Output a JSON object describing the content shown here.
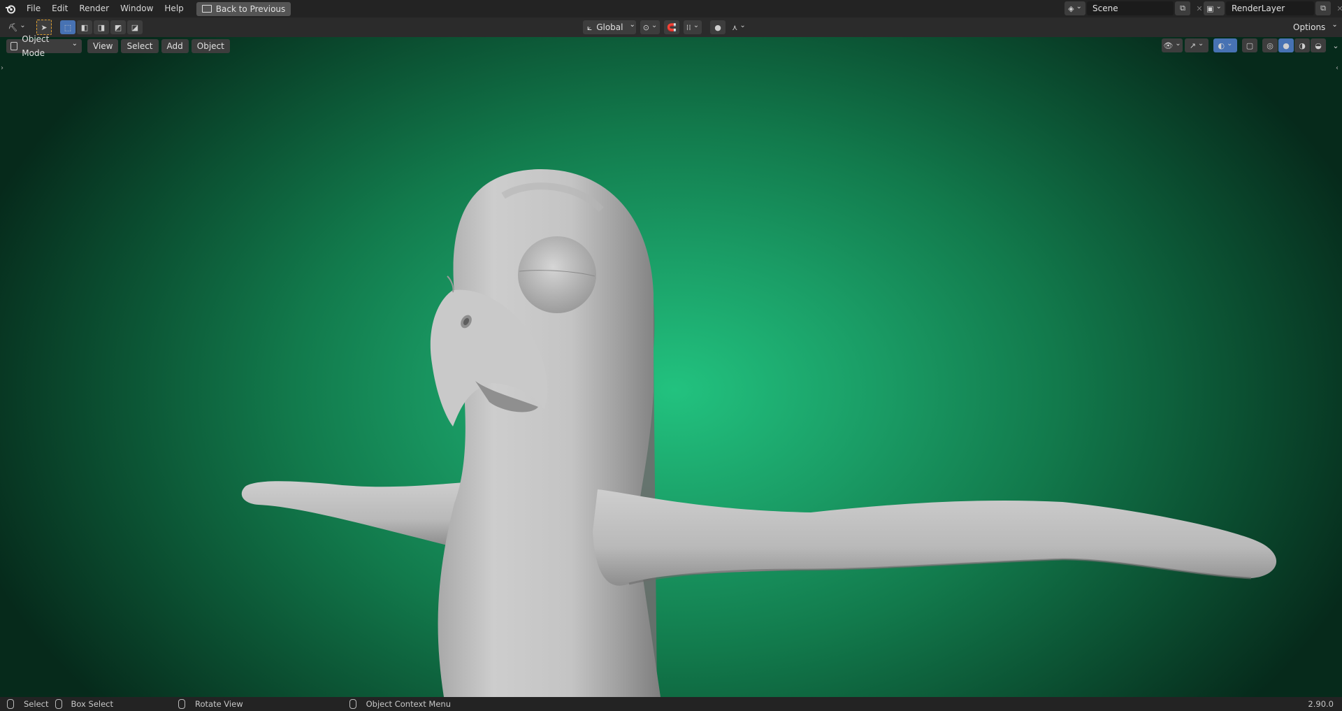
{
  "menu": {
    "items": [
      "File",
      "Edit",
      "Render",
      "Window",
      "Help"
    ],
    "back_button": "Back to Previous"
  },
  "scene": {
    "label": "Scene",
    "layer": "RenderLayer"
  },
  "toolbar": {
    "orientation": "Global",
    "options": "Options"
  },
  "viewport_header": {
    "mode": "Object Mode",
    "menus": [
      "View",
      "Select",
      "Add",
      "Object"
    ]
  },
  "status": {
    "select": "Select",
    "box_select": "Box Select",
    "rotate_view": "Rotate View",
    "context_menu": "Object Context Menu",
    "version": "2.90.0"
  },
  "colors": {
    "viewport_center": "#22c27f",
    "viewport_edge": "#062a1b",
    "accent": "#4772b3"
  }
}
